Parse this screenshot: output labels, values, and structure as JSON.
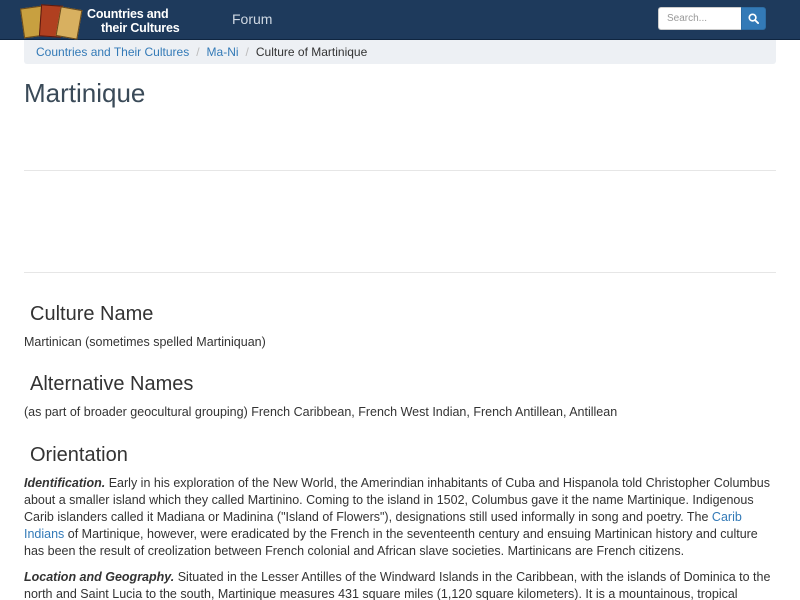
{
  "site": {
    "logo_line1": "Countries and",
    "logo_line2": "their Cultures",
    "nav_forum": "Forum"
  },
  "search": {
    "placeholder": "Search..."
  },
  "breadcrumb": {
    "items": [
      "Countries and Their Cultures",
      "Ma-Ni",
      "Culture of Martinique"
    ]
  },
  "page": {
    "title": "Martinique"
  },
  "sections": {
    "culture_name": {
      "heading": "Culture Name",
      "text": "Martinican (sometimes spelled Martiniquan)"
    },
    "alternative_names": {
      "heading": "Alternative Names",
      "text": "(as part of broader geocultural grouping) French Caribbean, French West Indian, French Antillean, Antillean"
    },
    "orientation": {
      "heading": "Orientation",
      "identification_label": "Identification.",
      "identification_text_1": " Early in his exploration of the New World, the Amerindian inhabitants of Cuba and Hispanola told Christopher Columbus about a smaller island which they called Martinino. Coming to the island in 1502, Columbus gave it the name Martinique. Indigenous Carib islanders called it Madiana or Madinina (\"Island of Flowers\"), designations still used informally in song and poetry. The ",
      "identification_link": "Carib Indians",
      "identification_text_2": " of Martinique, however, were eradicated by the French in the seventeenth century and ensuing Martinican history and culture has been the result of creolization between French colonial and African slave societies. Martinicans are French citizens.",
      "location_label": "Location and Geography.",
      "location_text": " Situated in the Lesser Antilles of the Windward Islands in the Caribbean, with the islands of Dominica to the north and Saint Lucia to the south, Martinique measures 431 square miles (1,120 square kilometers). It is a mountainous, tropical"
    }
  },
  "colors": {
    "navbar": "#1e3a5c",
    "link": "#337ab7",
    "search_button": "#337ab7"
  }
}
